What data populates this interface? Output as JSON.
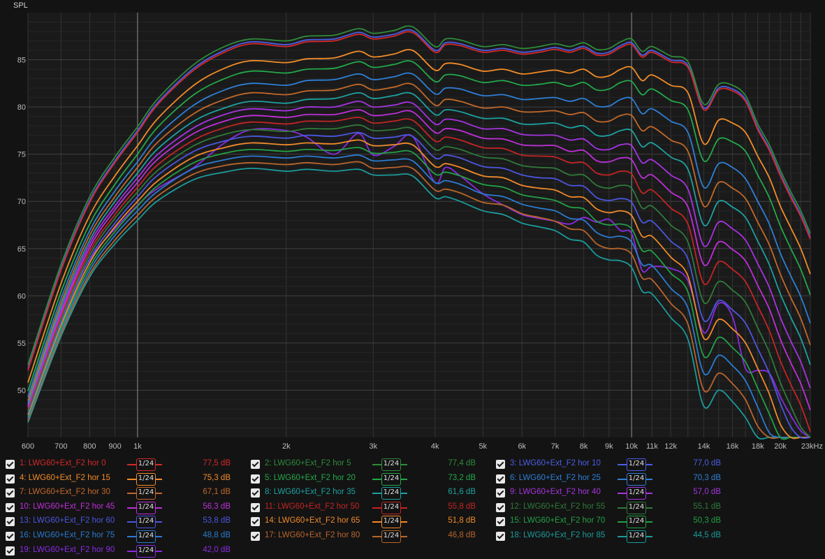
{
  "chart_data": {
    "type": "line",
    "ylabel": "SPL",
    "x_axis": {
      "scale": "log",
      "xlim": [
        600,
        23000
      ],
      "tick_values": [
        600,
        700,
        800,
        900,
        1000,
        2000,
        3000,
        4000,
        5000,
        6000,
        7000,
        8000,
        9000,
        10000,
        11000,
        12000,
        14000,
        16000,
        18000,
        20000,
        23000
      ],
      "tick_labels": [
        "600",
        "700",
        "800",
        "900",
        "1k",
        "2k",
        "3k",
        "4k",
        "5k",
        "6k",
        "7k",
        "8k",
        "9k",
        "10k",
        "11k",
        "12k",
        "14k",
        "16k",
        "18k",
        "20k",
        "23kHz"
      ]
    },
    "y_axis": {
      "ylim": [
        45,
        90
      ],
      "tick_values": [
        50,
        55,
        60,
        65,
        70,
        75,
        80,
        85
      ],
      "tick_labels": [
        "50",
        "55",
        "60",
        "65",
        "70",
        "75",
        "80",
        "85"
      ]
    },
    "grid": true,
    "x": [
      600,
      700,
      800,
      900,
      1000,
      1100,
      1300,
      1500,
      1700,
      2000,
      2200,
      2500,
      2800,
      3000,
      3300,
      3600,
      4000,
      4200,
      4500,
      5000,
      5500,
      6000,
      6500,
      7000,
      7500,
      8000,
      8500,
      9000,
      9500,
      10000,
      10500,
      11000,
      12000,
      13000,
      14000,
      15000,
      16000,
      17000,
      18000,
      19000,
      20000,
      21000,
      22000,
      23000
    ],
    "series": [
      {
        "name": "1: LWG60+Ext_F2 hor 0",
        "color": "#d42828",
        "values": [
          52.1,
          62.7,
          69.9,
          74.1,
          77.3,
          80.3,
          83.9,
          85.8,
          86.7,
          86.4,
          86.9,
          87.0,
          87.7,
          87.2,
          87.5,
          87.9,
          85.8,
          86.6,
          86.5,
          85.8,
          86.0,
          85.6,
          85.8,
          86.1,
          85.8,
          86.2,
          85.5,
          85.6,
          86.3,
          86.6,
          85.3,
          85.8,
          84.8,
          84.2,
          79.7,
          81.8,
          81.7,
          80.6,
          77.6,
          75.4,
          72.7,
          70.4,
          68.4,
          66.0
        ]
      },
      {
        "name": "2: LWG60+Ext_F2 hor 5",
        "color": "#2e8b3c",
        "values": [
          52.7,
          63.3,
          70.5,
          74.7,
          77.9,
          80.9,
          84.5,
          86.4,
          87.2,
          87.0,
          87.5,
          87.6,
          88.3,
          87.8,
          88.1,
          88.5,
          86.4,
          87.2,
          87.1,
          86.4,
          86.6,
          86.2,
          86.4,
          86.7,
          86.4,
          86.8,
          86.1,
          86.2,
          86.9,
          87.2,
          85.9,
          86.4,
          85.4,
          84.8,
          80.3,
          82.4,
          82.3,
          81.2,
          78.2,
          76.0,
          73.3,
          71.0,
          69.0,
          66.6
        ]
      },
      {
        "name": "3: LWG60+Ext_F2 hor 10",
        "color": "#4b5ee6",
        "values": [
          52.3,
          62.9,
          70.1,
          74.3,
          77.5,
          80.5,
          84.1,
          86.0,
          86.9,
          86.6,
          87.1,
          87.2,
          87.9,
          87.4,
          87.7,
          88.1,
          86.0,
          86.8,
          86.7,
          86.0,
          86.2,
          85.8,
          86.0,
          86.3,
          86.0,
          86.4,
          85.7,
          85.8,
          86.5,
          86.8,
          85.5,
          86.0,
          85.0,
          84.4,
          79.9,
          82.0,
          81.9,
          80.8,
          77.8,
          75.6,
          72.9,
          70.6,
          68.6,
          66.2
        ]
      },
      {
        "name": "4: LWG60+Ext_F2 hor 15",
        "color": "#f28c28",
        "values": [
          50.8,
          61.3,
          68.5,
          72.7,
          75.9,
          78.8,
          82.3,
          84.1,
          84.9,
          84.7,
          85.1,
          85.2,
          85.9,
          85.3,
          85.6,
          86.0,
          83.9,
          84.6,
          84.5,
          83.8,
          84.0,
          83.5,
          83.7,
          83.9,
          83.6,
          84.0,
          83.2,
          83.3,
          84.0,
          84.2,
          82.8,
          83.4,
          82.3,
          81.5,
          76.1,
          78.6,
          78.3,
          77.3,
          74.8,
          72.5,
          69.5,
          67.2,
          65.0,
          62.3
        ]
      },
      {
        "name": "5: LWG60+Ext_F2 hor 20",
        "color": "#23a84a",
        "values": [
          49.9,
          60.4,
          67.6,
          71.8,
          75.0,
          77.9,
          81.3,
          83.0,
          83.8,
          83.6,
          84.0,
          84.1,
          84.8,
          84.2,
          84.5,
          84.8,
          82.7,
          83.4,
          83.3,
          82.6,
          82.8,
          82.3,
          82.4,
          82.6,
          82.2,
          82.6,
          81.8,
          81.9,
          82.6,
          82.7,
          81.3,
          81.9,
          80.7,
          79.7,
          74.3,
          76.6,
          76.3,
          75.3,
          72.8,
          70.4,
          67.4,
          65.0,
          62.8,
          60.1
        ]
      },
      {
        "name": "6: LWG60+Ext_F2 hor 25",
        "color": "#2e7fd6",
        "values": [
          49.3,
          59.7,
          66.9,
          71.1,
          74.2,
          77.0,
          80.2,
          81.8,
          82.5,
          82.3,
          82.8,
          82.9,
          83.5,
          82.9,
          83.2,
          83.5,
          81.4,
          82.0,
          81.9,
          81.2,
          81.3,
          80.8,
          80.9,
          81.0,
          80.6,
          80.9,
          80.1,
          80.1,
          80.8,
          80.9,
          79.3,
          79.8,
          78.5,
          77.3,
          71.5,
          74.0,
          73.6,
          72.4,
          70.0,
          67.6,
          64.5,
          62.1,
          59.9,
          57.1
        ]
      },
      {
        "name": "7: LWG60+Ext_F2 hor 30",
        "color": "#c2692a",
        "values": [
          48.9,
          59.2,
          66.4,
          70.5,
          73.6,
          76.3,
          79.3,
          80.8,
          81.5,
          81.3,
          81.7,
          81.8,
          82.4,
          81.8,
          82.1,
          82.4,
          80.2,
          80.8,
          80.6,
          79.9,
          80.0,
          79.5,
          79.5,
          79.6,
          79.2,
          79.4,
          78.5,
          78.5,
          79.1,
          79.1,
          77.5,
          77.9,
          76.5,
          75.3,
          69.5,
          72.0,
          71.4,
          70.3,
          67.8,
          65.4,
          62.3,
          59.8,
          57.6,
          54.8
        ]
      },
      {
        "name": "8: LWG60+Ext_F2 hor 35",
        "color": "#1ea0a0",
        "values": [
          48.6,
          58.8,
          65.9,
          70.0,
          73.0,
          75.6,
          78.5,
          79.9,
          80.6,
          80.4,
          80.8,
          80.9,
          81.5,
          80.9,
          81.2,
          81.4,
          79.2,
          79.7,
          79.5,
          78.8,
          78.8,
          78.2,
          78.2,
          78.3,
          77.8,
          78.0,
          77.0,
          77.0,
          77.5,
          77.5,
          75.8,
          76.2,
          74.7,
          73.4,
          67.5,
          70.0,
          69.4,
          68.3,
          65.8,
          63.3,
          60.2,
          57.7,
          55.5,
          52.7
        ]
      },
      {
        "name": "9: LWG60+Ext_F2 hor 40",
        "color": "#a534e0",
        "values": [
          48.4,
          58.4,
          65.5,
          69.5,
          72.5,
          75.0,
          77.8,
          79.2,
          79.8,
          79.6,
          80.0,
          80.0,
          80.6,
          80.0,
          80.2,
          80.4,
          78.2,
          78.7,
          78.5,
          77.7,
          77.7,
          77.1,
          77.0,
          77.0,
          76.5,
          76.6,
          75.6,
          75.5,
          76.0,
          75.9,
          74.1,
          74.4,
          72.8,
          71.3,
          65.3,
          67.8,
          67.1,
          65.9,
          63.4,
          60.9,
          57.7,
          55.2,
          53.0,
          50.2
        ]
      },
      {
        "name": "10: LWG60+Ext_F2 hor 45",
        "color": "#bf2fd9",
        "values": [
          48.2,
          58.1,
          65.1,
          69.1,
          72.0,
          74.5,
          77.2,
          78.5,
          79.1,
          78.9,
          79.2,
          79.2,
          79.7,
          79.1,
          79.3,
          79.5,
          77.3,
          77.7,
          77.5,
          76.7,
          76.6,
          76.0,
          75.9,
          75.9,
          75.3,
          75.4,
          74.3,
          74.2,
          74.6,
          74.4,
          72.5,
          72.8,
          71.0,
          69.4,
          63.3,
          65.7,
          64.9,
          63.7,
          61.1,
          58.6,
          55.4,
          52.9,
          50.7,
          47.9
        ]
      },
      {
        "name": "11: LWG60+Ext_F2 hor 50",
        "color": "#c42424",
        "values": [
          48.0,
          57.8,
          64.7,
          68.6,
          71.5,
          73.9,
          76.5,
          77.8,
          78.4,
          78.2,
          78.5,
          78.5,
          78.9,
          78.3,
          78.5,
          78.6,
          76.4,
          76.8,
          76.5,
          75.7,
          75.6,
          74.9,
          74.8,
          74.7,
          74.1,
          74.1,
          73.0,
          72.8,
          73.2,
          72.9,
          70.9,
          71.2,
          69.3,
          67.6,
          61.3,
          63.6,
          62.8,
          61.5,
          58.9,
          56.3,
          53.1,
          50.6,
          48.4,
          45.6
        ]
      },
      {
        "name": "12: LWG60+Ext_F2 hor 55",
        "color": "#2f7a3a",
        "values": [
          47.8,
          57.5,
          64.3,
          68.2,
          71.0,
          73.3,
          75.9,
          77.1,
          77.6,
          77.4,
          77.7,
          77.7,
          78.1,
          77.5,
          77.6,
          77.7,
          75.5,
          75.8,
          75.5,
          74.7,
          74.5,
          73.8,
          73.6,
          73.5,
          72.8,
          72.8,
          71.7,
          71.4,
          71.7,
          71.4,
          69.3,
          69.5,
          67.5,
          65.7,
          59.3,
          61.5,
          60.6,
          59.3,
          56.6,
          54.0,
          50.8,
          48.3,
          46.1,
          45.0
        ]
      },
      {
        "name": "13: LWG60+Ext_F2 hor 60",
        "color": "#4a57df",
        "values": [
          47.6,
          57.2,
          63.9,
          67.7,
          70.5,
          72.8,
          75.3,
          76.4,
          76.9,
          76.7,
          77.0,
          76.9,
          77.3,
          76.7,
          76.8,
          76.9,
          74.6,
          74.9,
          74.6,
          73.7,
          73.5,
          72.8,
          72.5,
          72.4,
          71.7,
          71.6,
          70.4,
          70.1,
          70.3,
          69.9,
          67.8,
          67.9,
          65.8,
          63.9,
          57.4,
          59.5,
          58.5,
          57.1,
          54.4,
          51.8,
          48.6,
          46.1,
          45.0,
          45.0
        ]
      },
      {
        "name": "14: LWG60+Ext_F2 hor 65",
        "color": "#f08a2a",
        "values": [
          47.4,
          56.9,
          63.5,
          67.3,
          70.0,
          72.2,
          74.7,
          75.7,
          76.2,
          76.0,
          76.2,
          76.1,
          76.5,
          75.9,
          76.0,
          76.0,
          73.7,
          74.0,
          73.6,
          72.7,
          72.5,
          71.7,
          71.4,
          71.2,
          70.5,
          70.4,
          69.2,
          68.8,
          69.0,
          68.5,
          66.3,
          66.3,
          64.1,
          62.1,
          55.5,
          57.5,
          56.5,
          55.0,
          52.3,
          49.6,
          46.4,
          45.0,
          45.0,
          45.0
        ]
      },
      {
        "name": "15: LWG60+Ext_F2 hor 70",
        "color": "#22a045",
        "values": [
          47.2,
          56.6,
          63.1,
          66.8,
          69.5,
          71.7,
          74.1,
          75.1,
          75.5,
          75.3,
          75.5,
          75.4,
          75.7,
          75.1,
          75.2,
          75.2,
          72.9,
          73.1,
          72.7,
          71.8,
          71.5,
          70.7,
          70.4,
          70.1,
          69.4,
          69.2,
          67.9,
          67.5,
          67.6,
          67.1,
          64.8,
          64.7,
          62.4,
          60.4,
          53.6,
          55.6,
          54.5,
          53.0,
          50.2,
          47.5,
          45.0,
          45.0,
          45.0,
          45.0
        ]
      },
      {
        "name": "16: LWG60+Ext_F2 hor 75",
        "color": "#2b7bd0",
        "values": [
          47.0,
          56.3,
          62.7,
          66.4,
          69.0,
          71.1,
          73.5,
          74.4,
          74.8,
          74.6,
          74.8,
          74.6,
          74.9,
          74.3,
          74.4,
          74.3,
          72.0,
          72.2,
          71.8,
          70.8,
          70.5,
          69.7,
          69.3,
          69.0,
          68.2,
          68.0,
          66.7,
          66.2,
          66.3,
          65.7,
          63.3,
          63.2,
          60.8,
          58.7,
          51.8,
          53.7,
          52.6,
          51.0,
          48.2,
          45.5,
          45.0,
          45.0,
          45.0,
          45.0
        ]
      },
      {
        "name": "17: LWG60+Ext_F2 hor 80",
        "color": "#b8652c",
        "values": [
          46.8,
          56.0,
          62.3,
          65.9,
          68.5,
          70.6,
          72.9,
          73.8,
          74.1,
          73.9,
          74.1,
          73.9,
          74.2,
          73.5,
          73.6,
          73.5,
          71.2,
          71.3,
          70.9,
          69.9,
          69.6,
          68.7,
          68.3,
          67.9,
          67.1,
          66.9,
          65.5,
          65.0,
          65.0,
          64.4,
          61.9,
          61.7,
          59.2,
          57.0,
          50.0,
          51.8,
          50.7,
          49.0,
          46.2,
          45.0,
          45.0,
          45.0,
          45.0,
          45.0
        ]
      },
      {
        "name": "18: LWG60+Ext_F2 hor 85",
        "color": "#1c9a9a",
        "values": [
          46.6,
          55.7,
          62.0,
          65.5,
          68.0,
          70.1,
          72.3,
          73.1,
          73.5,
          73.2,
          73.4,
          73.2,
          73.4,
          72.8,
          72.8,
          72.7,
          70.4,
          70.5,
          70.0,
          69.0,
          68.6,
          67.7,
          67.3,
          66.9,
          66.0,
          65.7,
          64.3,
          63.8,
          63.7,
          63.0,
          60.5,
          60.2,
          57.7,
          55.4,
          48.3,
          50.0,
          48.8,
          47.1,
          45.0,
          45.0,
          45.0,
          45.0,
          45.0,
          45.0
        ]
      },
      {
        "name": "19: LWG60+Ext_F2 hor 90",
        "color": "#8a2be2",
        "values": [
          48.4,
          57.8,
          63.8,
          67.1,
          69.6,
          71.4,
          73.6,
          76.2,
          77.6,
          77.5,
          76.8,
          75.0,
          77.2,
          74.9,
          75.8,
          76.9,
          72.0,
          73.6,
          72.7,
          70.8,
          69.6,
          68.6,
          68.2,
          67.9,
          67.6,
          68.3,
          67.8,
          68.1,
          66.9,
          66.6,
          62.7,
          63.1,
          62.9,
          61.6,
          56.1,
          59.2,
          57.8,
          52.3,
          52.1,
          51.8,
          49.3,
          47.3,
          45.7,
          45.0
        ]
      }
    ]
  },
  "legend": [
    {
      "label": "1: LWG60+Ext_F2 hor 0",
      "smooth": "1/24",
      "value": "77,5 dB",
      "color": "#d42828"
    },
    {
      "label": "2: LWG60+Ext_F2 hor 5",
      "smooth": "1/24",
      "value": "77,4 dB",
      "color": "#2e8b3c"
    },
    {
      "label": "3: LWG60+Ext_F2 hor 10",
      "smooth": "1/24",
      "value": "77,0 dB",
      "color": "#4b5ee6"
    },
    {
      "label": "4: LWG60+Ext_F2 hor 15",
      "smooth": "1/24",
      "value": "75,3 dB",
      "color": "#f28c28"
    },
    {
      "label": "5: LWG60+Ext_F2 hor 20",
      "smooth": "1/24",
      "value": "73,2 dB",
      "color": "#23a84a"
    },
    {
      "label": "6: LWG60+Ext_F2 hor 25",
      "smooth": "1/24",
      "value": "70,3 dB",
      "color": "#2e7fd6"
    },
    {
      "label": "7: LWG60+Ext_F2 hor 30",
      "smooth": "1/24",
      "value": "67,1 dB",
      "color": "#c2692a"
    },
    {
      "label": "8: LWG60+Ext_F2 hor 35",
      "smooth": "1/24",
      "value": "61,6 dB",
      "color": "#1ea0a0"
    },
    {
      "label": "9: LWG60+Ext_F2 hor 40",
      "smooth": "1/24",
      "value": "57,0 dB",
      "color": "#a534e0"
    },
    {
      "label": "10: LWG60+Ext_F2 hor 45",
      "smooth": "1/24",
      "value": "56,3 dB",
      "color": "#bf2fd9"
    },
    {
      "label": "11: LWG60+Ext_F2 hor 50",
      "smooth": "1/24",
      "value": "55,8 dB",
      "color": "#c42424"
    },
    {
      "label": "12: LWG60+Ext_F2 hor 55",
      "smooth": "1/24",
      "value": "55,1 dB",
      "color": "#2f7a3a"
    },
    {
      "label": "13: LWG60+Ext_F2 hor 60",
      "smooth": "1/24",
      "value": "53,8 dB",
      "color": "#4a57df"
    },
    {
      "label": "14: LWG60+Ext_F2 hor 65",
      "smooth": "1/24",
      "value": "51,8 dB",
      "color": "#f08a2a"
    },
    {
      "label": "15: LWG60+Ext_F2 hor 70",
      "smooth": "1/24",
      "value": "50,3 dB",
      "color": "#22a045"
    },
    {
      "label": "16: LWG60+Ext_F2 hor 75",
      "smooth": "1/24",
      "value": "48,8 dB",
      "color": "#2b7bd0"
    },
    {
      "label": "17: LWG60+Ext_F2 hor 80",
      "smooth": "1/24",
      "value": "46,8 dB",
      "color": "#b8652c"
    },
    {
      "label": "18: LWG60+Ext_F2 hor 85",
      "smooth": "1/24",
      "value": "44,5 dB",
      "color": "#1c9a9a"
    },
    {
      "label": "19: LWG60+Ext_F2 hor 90",
      "smooth": "1/24",
      "value": "42,0 dB",
      "color": "#8a2be2"
    }
  ],
  "colors": {
    "background": "#131313",
    "plot_bg": "#1a1a1a",
    "grid": "#343434",
    "grid_major": "#5a5a5a",
    "axis_text": "#bdbdbd"
  }
}
